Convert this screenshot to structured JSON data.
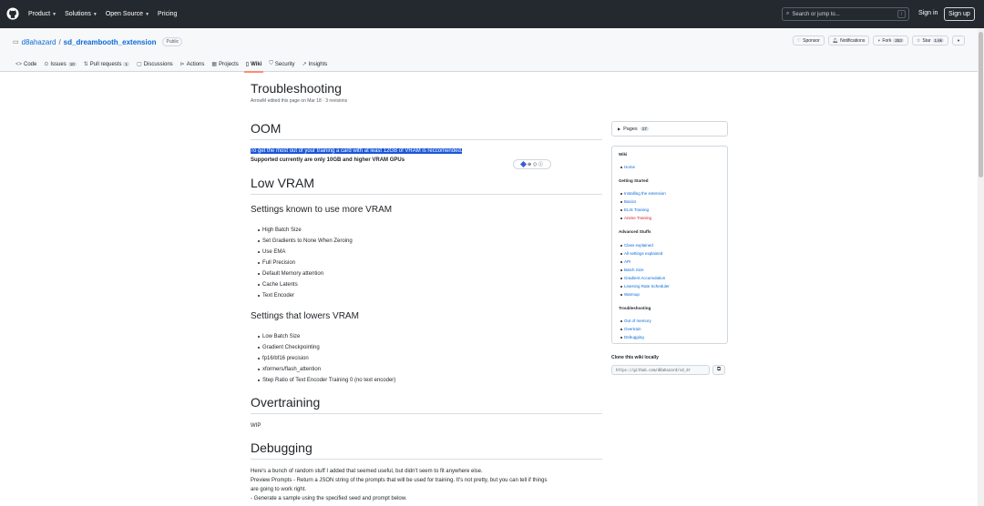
{
  "topbar": {
    "nav": [
      {
        "label": "Product",
        "chevron": true
      },
      {
        "label": "Solutions",
        "chevron": true
      },
      {
        "label": "Open Source",
        "chevron": true
      },
      {
        "label": "Pricing",
        "chevron": false
      }
    ],
    "search_placeholder": "Search or jump to...",
    "search_shortcut": "/",
    "signin": "Sign in",
    "signup": "Sign up"
  },
  "repo": {
    "owner": "d8ahazard",
    "separator": "/",
    "name": "sd_dreambooth_extension",
    "visibility": "Public",
    "sponsor": "Sponsor",
    "notifications": "Notifications",
    "fork_label": "Fork",
    "fork_count": "253",
    "star_label": "Star",
    "star_count": "1.6k",
    "tabs": [
      {
        "label": "Code",
        "icon": "code-icon"
      },
      {
        "label": "Issues",
        "count": "10",
        "icon": "issue-icon"
      },
      {
        "label": "Pull requests",
        "count": "1",
        "icon": "pull-request-icon"
      },
      {
        "label": "Discussions",
        "icon": "discussion-icon"
      },
      {
        "label": "Actions",
        "icon": "actions-icon"
      },
      {
        "label": "Projects",
        "icon": "projects-icon"
      },
      {
        "label": "Wiki",
        "icon": "book-icon",
        "active": true
      },
      {
        "label": "Security",
        "icon": "shield-icon"
      },
      {
        "label": "Insights",
        "icon": "graph-icon"
      }
    ]
  },
  "wiki": {
    "title": "Troubleshooting",
    "meta": "ArrowM edited this page on Mar 18 · 3 revisions",
    "oom": {
      "heading": "OOM",
      "selected_line": "To get the most out of your training a card with at least 12GB of VRAM is reccomended.",
      "bold_line": "Supported currently are only 10GB and higher VRAM GPUs"
    },
    "lowvram": {
      "heading": "Low VRAM",
      "more_heading": "Settings known to use more VRAM",
      "more_items": [
        "High Batch Size",
        "Set Gradients to None When Zeroing",
        "Use EMA",
        "Full Precision",
        "Default Memory attention",
        "Cache Latents",
        "Text Encoder"
      ],
      "lower_heading": "Settings that lowers VRAM",
      "lower_items": [
        "Low Batch Size",
        "Gradient Checkpointing",
        "fp16/bf16 precision",
        "xformers/flash_attention",
        "Step Ratio of Text Encoder Training 0 (no text encoder)"
      ]
    },
    "overtraining": {
      "heading": "Overtraining",
      "text": "WIP"
    },
    "debugging": {
      "heading": "Debugging",
      "line1": "Here's a bunch of random stuff I added that seemed useful, but didn't seem to fit anywhere else.",
      "line2": "Preview Prompts - Return a JSON string of the prompts that will be used for training. It's not pretty, but you can tell if things",
      "line3": "are going to work right.",
      "line4": "- Generate a sample using the specified seed and prompt below."
    }
  },
  "sidebar": {
    "pages_label": "Pages",
    "pages_count": "17",
    "sections": [
      {
        "title": "Wiki",
        "links": [
          {
            "label": "Home"
          }
        ]
      },
      {
        "title": "Getting Started",
        "links": [
          {
            "label": "Installing the extension"
          },
          {
            "label": "Basics"
          },
          {
            "label": "ELIS Training"
          },
          {
            "label": "Anime Training",
            "red": true
          }
        ]
      },
      {
        "title": "Advanced Stuffs",
        "links": [
          {
            "label": "Class explained"
          },
          {
            "label": "All settings explained"
          },
          {
            "label": "API"
          },
          {
            "label": "Batch Size"
          },
          {
            "label": "Gradient Accumulation"
          },
          {
            "label": "Learning Rate Scheduler"
          },
          {
            "label": "Warmup"
          }
        ]
      },
      {
        "title": "Troubleshooting",
        "links": [
          {
            "label": "Out of memory"
          },
          {
            "label": "Overtrain"
          },
          {
            "label": "Debugging"
          }
        ]
      }
    ],
    "clone_label": "Clone this wiki locally",
    "clone_url": "https://github.com/d8ahazard/sd_dr"
  },
  "colors": {
    "header_bg": "#24292f",
    "link": "#0969da",
    "selection": "#1a56d9",
    "active_tab_underline": "#fd8c73",
    "red_link": "#cf222e"
  }
}
